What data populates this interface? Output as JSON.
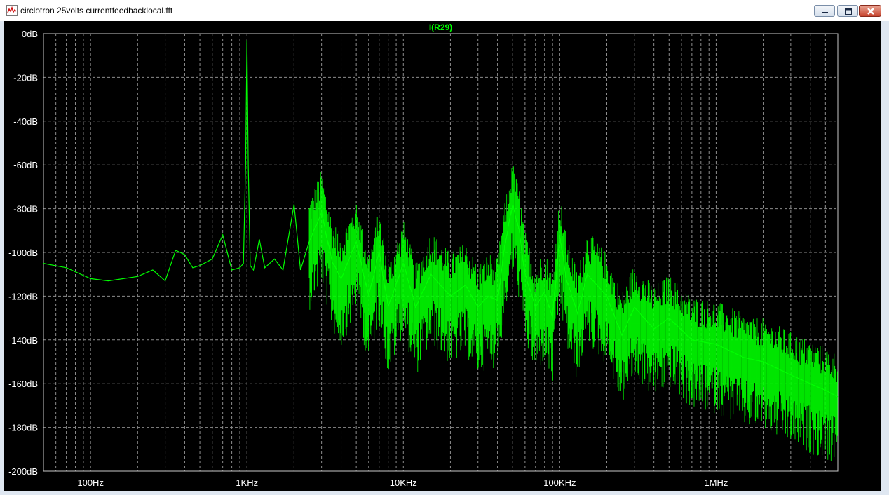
{
  "window": {
    "title": "circlotron 25volts currentfeedbacklocal.fft",
    "buttons": {
      "minimize": "minimize",
      "maximize": "maximize",
      "close": "close"
    }
  },
  "colors": {
    "trace": "#00ff00",
    "background": "#000000",
    "grid": "#8c8c8c",
    "axis_labels": "#ffffff"
  },
  "chart_data": {
    "type": "line",
    "title": "I(R29)",
    "xlabel": "",
    "ylabel": "",
    "x_scale": "log",
    "xlim": [
      50,
      6000000
    ],
    "ylim": [
      -200,
      0
    ],
    "y_ticks": [
      {
        "value": 0,
        "label": "0dB"
      },
      {
        "value": -20,
        "label": "-20dB"
      },
      {
        "value": -40,
        "label": "-40dB"
      },
      {
        "value": -60,
        "label": "-60dB"
      },
      {
        "value": -80,
        "label": "-80dB"
      },
      {
        "value": -100,
        "label": "-100dB"
      },
      {
        "value": -120,
        "label": "-120dB"
      },
      {
        "value": -140,
        "label": "-140dB"
      },
      {
        "value": -160,
        "label": "-160dB"
      },
      {
        "value": -180,
        "label": "-180dB"
      },
      {
        "value": -200,
        "label": "-200dB"
      }
    ],
    "x_ticks": [
      {
        "value": 100,
        "label": "100Hz"
      },
      {
        "value": 1000,
        "label": "1KHz"
      },
      {
        "value": 10000,
        "label": "10KHz"
      },
      {
        "value": 100000,
        "label": "100KHz"
      },
      {
        "value": 1000000,
        "label": "1MHz"
      }
    ],
    "grid": true,
    "series": [
      {
        "name": "I(R29)",
        "x": [
          50,
          70,
          100,
          130,
          200,
          250,
          300,
          350,
          400,
          450,
          500,
          600,
          700,
          800,
          900,
          950,
          980,
          1000,
          1020,
          1050,
          1100,
          1200,
          1300,
          1500,
          1700,
          2000,
          2200,
          2500,
          3000,
          3500,
          4000,
          5000,
          6000,
          7000,
          8000,
          10000,
          12000,
          15000,
          20000,
          25000,
          30000,
          35000,
          40000,
          45000,
          50000,
          55000,
          60000,
          70000,
          80000,
          90000,
          100000,
          110000,
          130000,
          150000,
          200000,
          250000,
          300000,
          400000,
          500000,
          700000,
          1000000,
          1500000,
          2000000,
          3000000,
          4000000,
          5000000,
          6000000
        ],
        "y": [
          -105,
          -107,
          -112,
          -113,
          -111,
          -108,
          -113,
          -99,
          -101,
          -107,
          -106,
          -103,
          -92,
          -108,
          -107,
          -105,
          -60,
          -3,
          -60,
          -106,
          -108,
          -94,
          -107,
          -103,
          -108,
          -78,
          -108,
          -95,
          -82,
          -104,
          -112,
          -95,
          -120,
          -100,
          -125,
          -105,
          -125,
          -110,
          -120,
          -115,
          -125,
          -120,
          -122,
          -95,
          -78,
          -90,
          -110,
          -125,
          -118,
          -130,
          -92,
          -112,
          -128,
          -110,
          -120,
          -138,
          -125,
          -135,
          -130,
          -140,
          -142,
          -148,
          -150,
          -156,
          -160,
          -163,
          -166
        ]
      }
    ]
  }
}
